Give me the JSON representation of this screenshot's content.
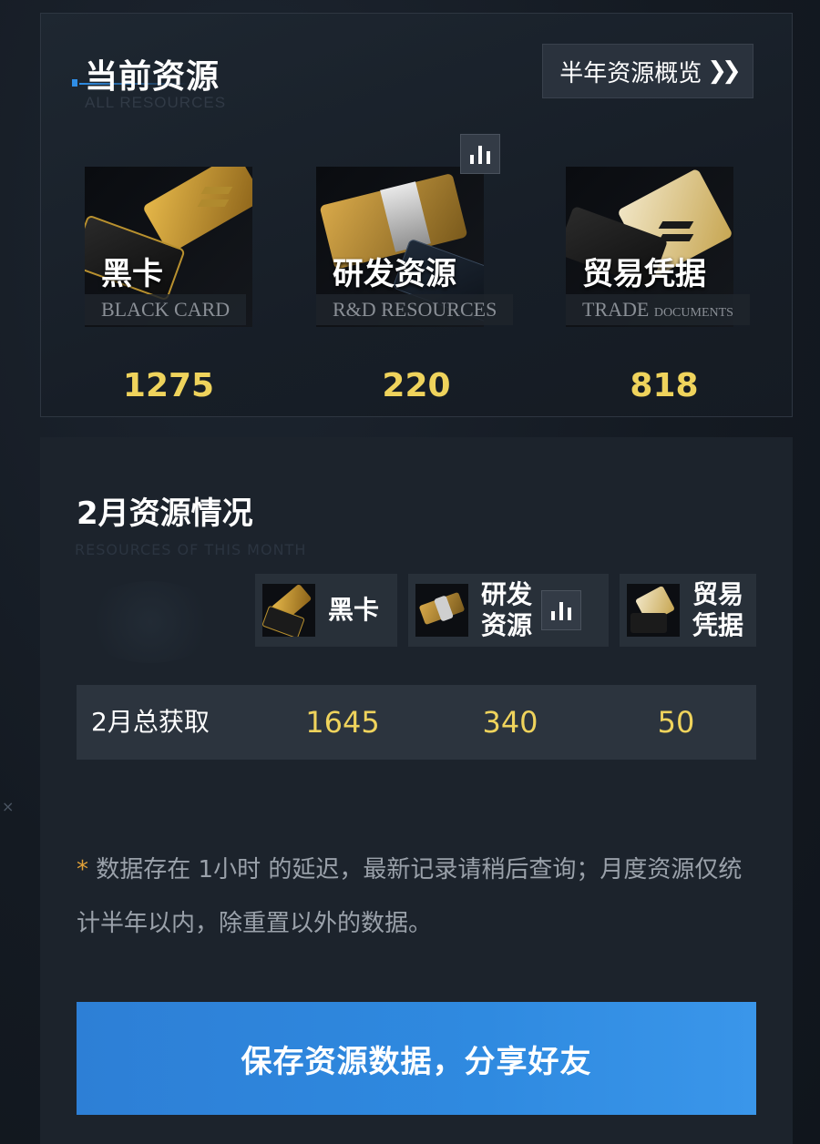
{
  "current_resources": {
    "title": "当前资源",
    "subtitle": "ALL RESOURCES",
    "overview_button": "半年资源概览",
    "overview_icon": "double-chevron-right-icon",
    "items": [
      {
        "name": "黑卡",
        "en": "BLACK CARD",
        "value": "1275"
      },
      {
        "name": "研发资源",
        "en": "R&D RESOURCES",
        "value": "220"
      },
      {
        "name": "贸易凭据",
        "en": "TRADE",
        "en_small": "DOCUMENTS",
        "value": "818"
      }
    ]
  },
  "monthly": {
    "title": "2月资源情况",
    "subtitle": "RESOURCES OF THIS MONTH",
    "headers": [
      {
        "label": "黑卡"
      },
      {
        "label_line1": "研发",
        "label_line2": "资源"
      },
      {
        "label_line1": "贸易",
        "label_line2": "凭据"
      }
    ],
    "total_row": {
      "label": "2月总获取",
      "values": [
        "1645",
        "340",
        "50"
      ]
    }
  },
  "note": {
    "star": "*",
    "text": " 数据存在 1小时 的延迟，最新记录请稍后查询；月度资源仅统计半年以内，除重置以外的数据。"
  },
  "share_button": "保存资源数据，分享好友",
  "colors": {
    "value_gold": "#efd35c",
    "button_blue": "#2f8ae0",
    "accent_blue": "#2f8ee6",
    "note_star": "#e2a238"
  }
}
